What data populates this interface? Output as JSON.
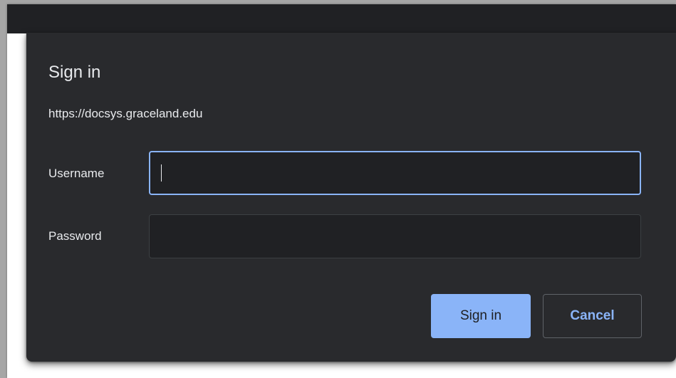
{
  "dialog": {
    "title": "Sign in",
    "origin": "https://docsys.graceland.edu"
  },
  "form": {
    "username": {
      "label": "Username",
      "value": "",
      "focused": true
    },
    "password": {
      "label": "Password",
      "value": ""
    }
  },
  "actions": {
    "sign_in_label": "Sign in",
    "cancel_label": "Cancel"
  },
  "colors": {
    "dialog_background": "#292a2d",
    "input_background": "#202124",
    "focus_border": "#8ab4f8",
    "primary_button": "#8ab4f8",
    "text": "#e8eaed"
  }
}
